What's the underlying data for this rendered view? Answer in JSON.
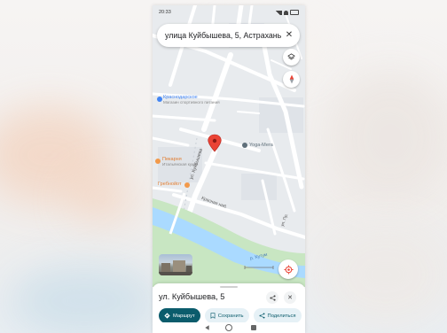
{
  "status_bar": {
    "time": "20:33",
    "icons": [
      "signal-icon",
      "wifi-icon",
      "battery-icon"
    ]
  },
  "search": {
    "query": "улица Куйбышева, 5, Астрахань",
    "icons": [
      "close-icon"
    ]
  },
  "map": {
    "controls": [
      "layers-icon",
      "compass-icon",
      "my-location-icon"
    ],
    "labels": {
      "krasnodarskaya": "Краснодарское",
      "krasnodarskaya_sub": "Магазин спортивного питания",
      "yoga": "Yoga-Мега",
      "pekarnya": "Пекарня",
      "pekarnya_sub": "Итальянская кухня",
      "grebnoy": "Гребнойот",
      "street_kuibysheva": "ул. Куйбышева",
      "street_krasnaya": "Красная наб.",
      "street_pr": "ул. Пр.",
      "river": "р. Кутум",
      "magnit": "Магнит"
    },
    "colors": {
      "background": "#e8ebee",
      "road": "#ffffff",
      "river": "#aadaff",
      "riverbank": "#c8e6c2",
      "pin": "#ea4335",
      "poi_orange": "#f2994a",
      "poi_blue": "#4285f4",
      "poi_gray": "#5f6f7a"
    }
  },
  "place_sheet": {
    "title": "ул. Куйбышева, 5",
    "actions": [
      {
        "label": "Маршрут",
        "icon": "directions-icon",
        "style": "primary"
      },
      {
        "label": "Сохранить",
        "icon": "bookmark-icon",
        "style": "secondary"
      },
      {
        "label": "Поделиться",
        "icon": "share-icon",
        "style": "secondary"
      }
    ],
    "accent_color": "#0b5c6c"
  },
  "nav_bar": {
    "icons": [
      "back-icon",
      "home-icon",
      "recents-icon"
    ]
  }
}
